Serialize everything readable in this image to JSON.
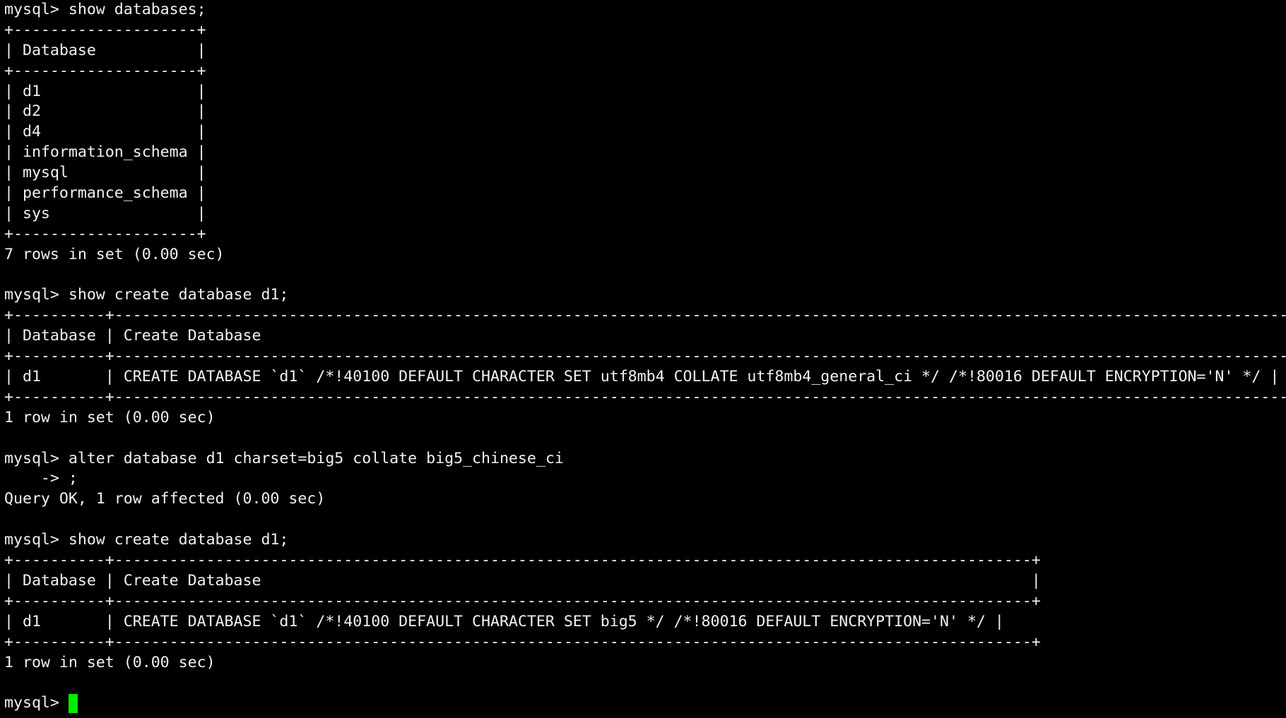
{
  "terminal": {
    "lines": [
      "mysql> show databases;",
      "+--------------------+",
      "| Database           |",
      "+--------------------+",
      "| d1                 |",
      "| d2                 |",
      "| d4                 |",
      "| information_schema |",
      "| mysql              |",
      "| performance_schema |",
      "| sys                |",
      "+--------------------+",
      "7 rows in set (0.00 sec)",
      "",
      "mysql> show create database d1;",
      "+----------+------------------------------------------------------------------------------------------------------------------------------------+",
      "| Database | Create Database                                                                                                                    |",
      "+----------+------------------------------------------------------------------------------------------------------------------------------------+",
      "| d1       | CREATE DATABASE `d1` /*!40100 DEFAULT CHARACTER SET utf8mb4 COLLATE utf8mb4_general_ci */ /*!80016 DEFAULT ENCRYPTION='N' */ |",
      "+----------+------------------------------------------------------------------------------------------------------------------------------------+",
      "1 row in set (0.00 sec)",
      "",
      "mysql> alter database d1 charset=big5 collate big5_chinese_ci",
      "    -> ;",
      "Query OK, 1 row affected (0.00 sec)",
      "",
      "mysql> show create database d1;",
      "+----------+----------------------------------------------------------------------------------------------------+",
      "| Database | Create Database                                                                                    |",
      "+----------+----------------------------------------------------------------------------------------------------+",
      "| d1       | CREATE DATABASE `d1` /*!40100 DEFAULT CHARACTER SET big5 */ /*!80016 DEFAULT ENCRYPTION='N' */ |",
      "+----------+----------------------------------------------------------------------------------------------------+",
      "1 row in set (0.00 sec)",
      ""
    ],
    "prompt": "mysql> ",
    "colors": {
      "background": "#000000",
      "foreground": "#f2f2f2",
      "cursor": "#00ee00"
    }
  }
}
